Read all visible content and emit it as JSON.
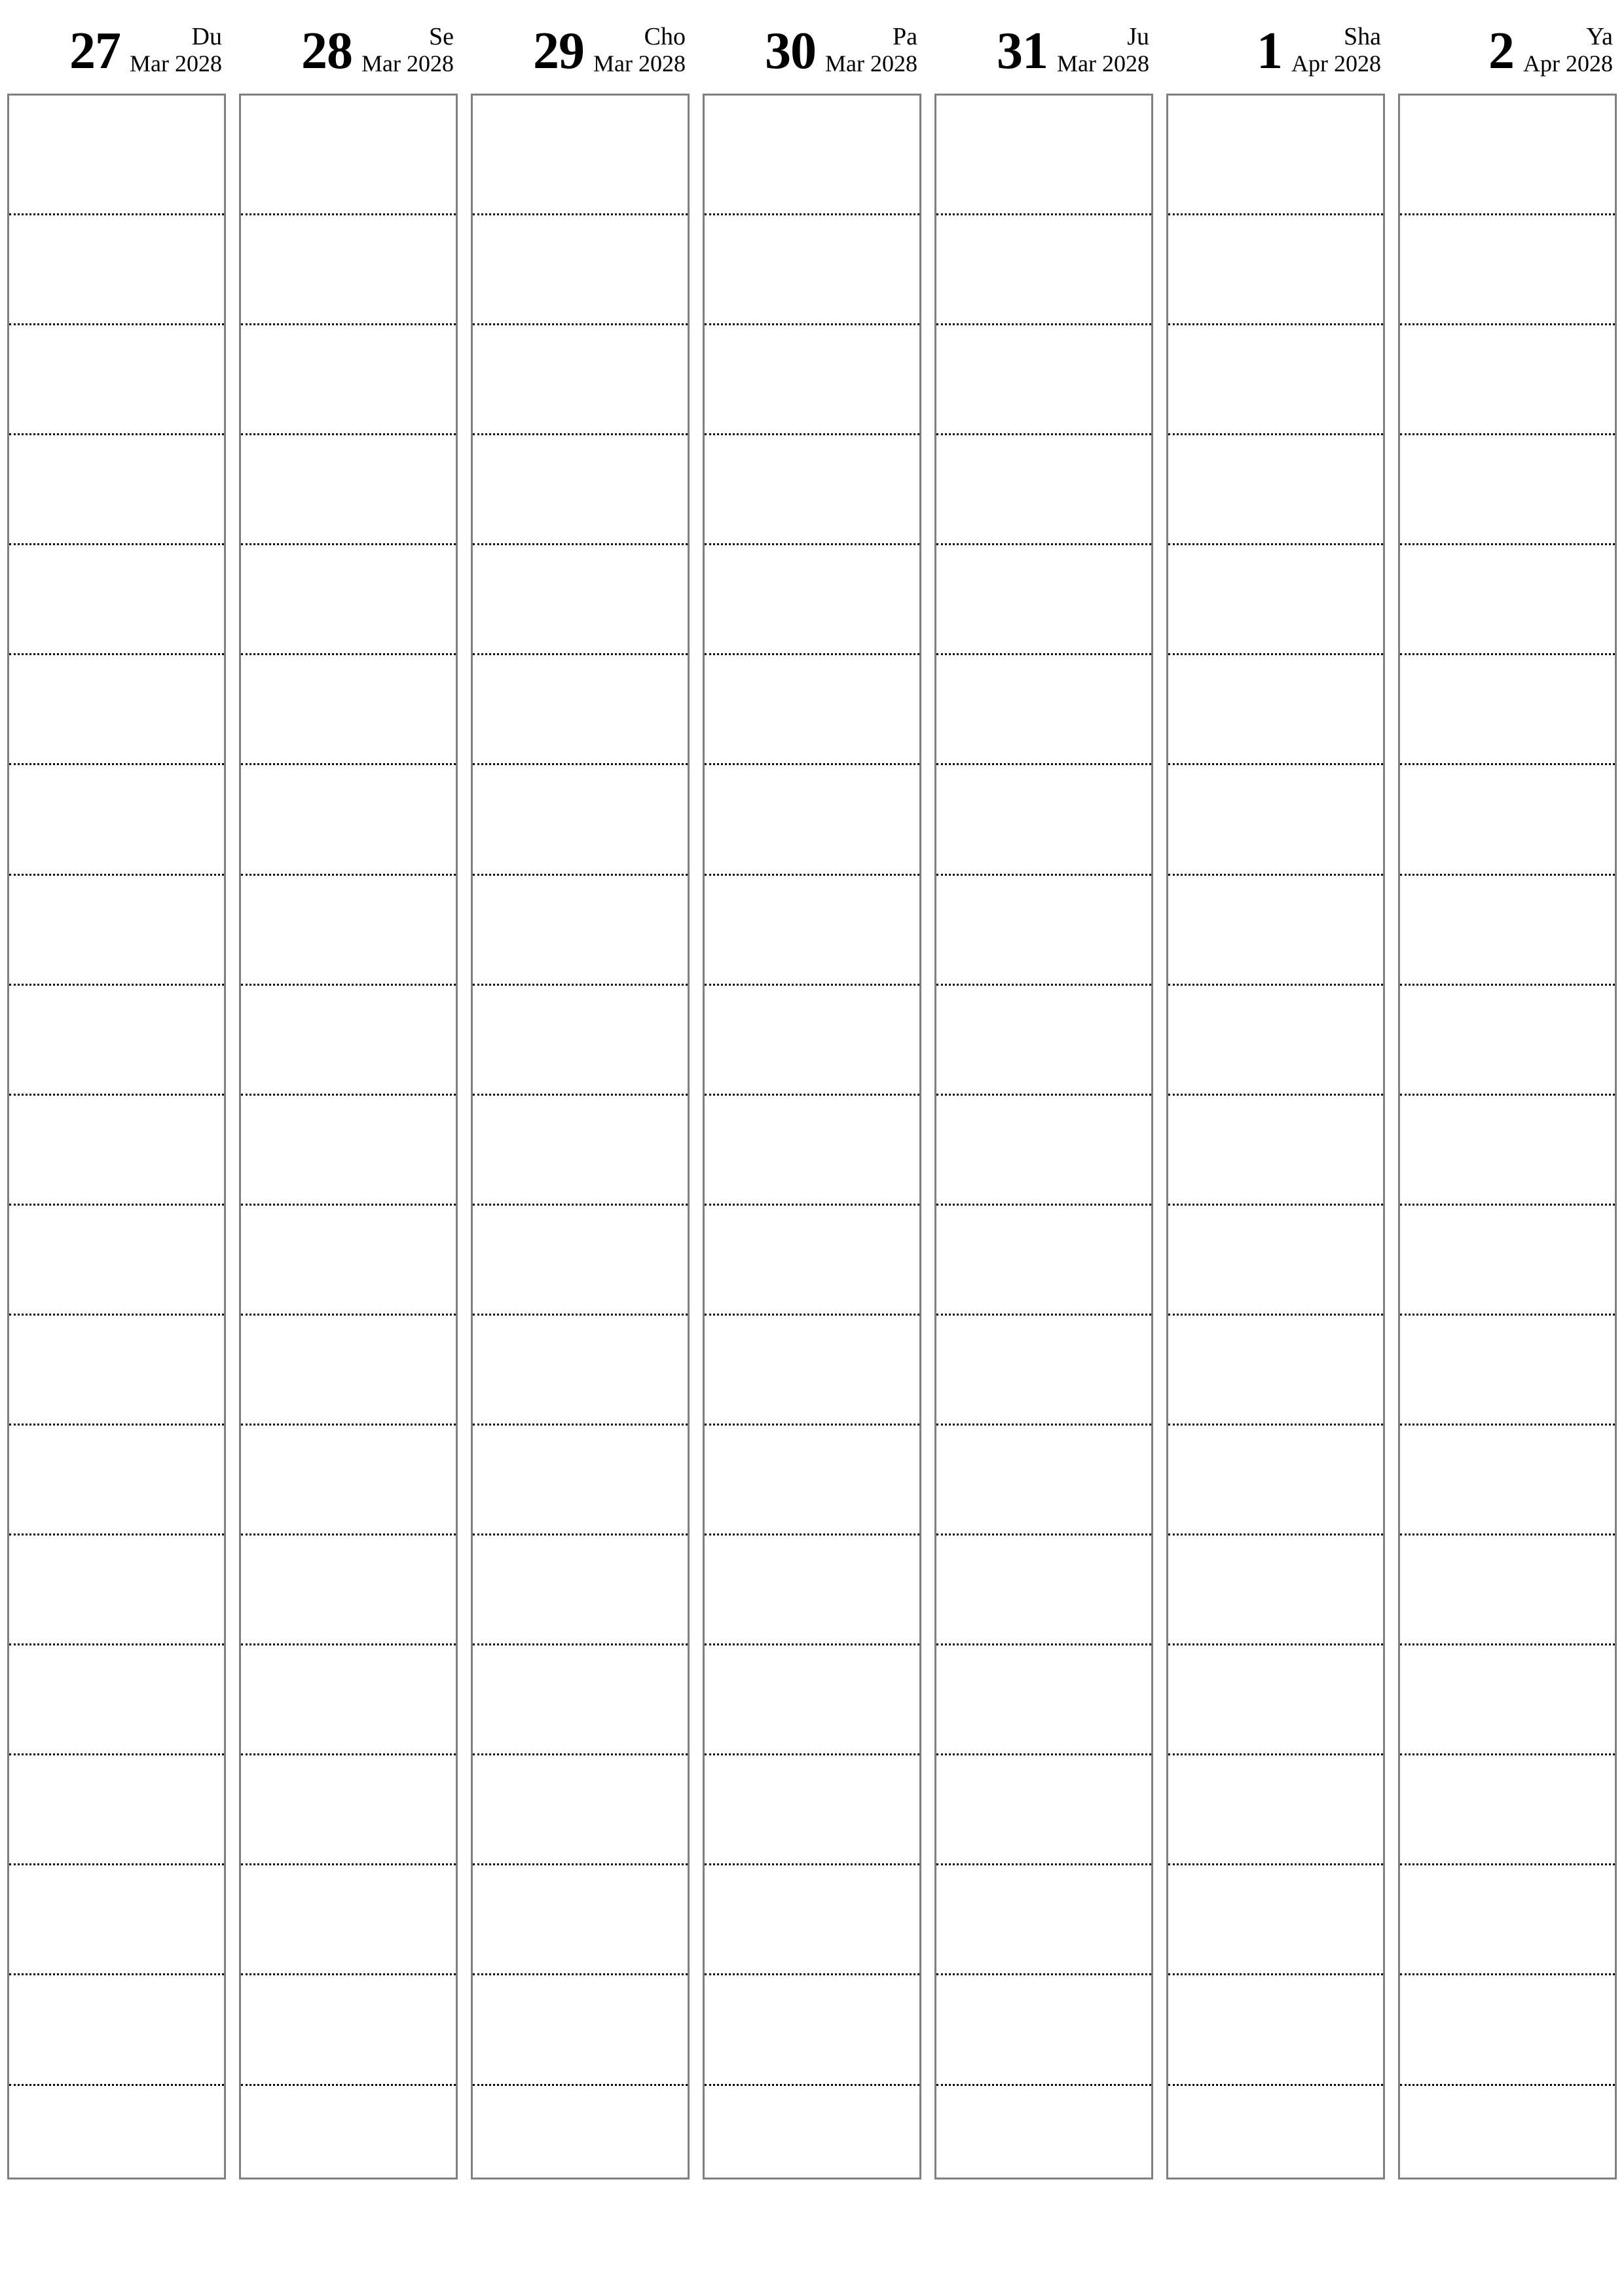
{
  "page": {
    "type": "weekly-planner",
    "orientation": "portrait",
    "background_color": "#ffffff",
    "border_color": "#808080",
    "rule_color": "#000000",
    "text_color": "#000000"
  },
  "week": {
    "days": [
      {
        "number": "27",
        "day_name": "Du",
        "month_year": "Mar 2028"
      },
      {
        "number": "28",
        "day_name": "Se",
        "month_year": "Mar 2028"
      },
      {
        "number": "29",
        "day_name": "Cho",
        "month_year": "Mar 2028"
      },
      {
        "number": "30",
        "day_name": "Pa",
        "month_year": "Mar 2028"
      },
      {
        "number": "31",
        "day_name": "Ju",
        "month_year": "Mar 2028"
      },
      {
        "number": "1",
        "day_name": "Sha",
        "month_year": "Apr 2028"
      },
      {
        "number": "2",
        "day_name": "Ya",
        "month_year": "Apr 2028"
      }
    ],
    "slots_per_day": 19
  }
}
